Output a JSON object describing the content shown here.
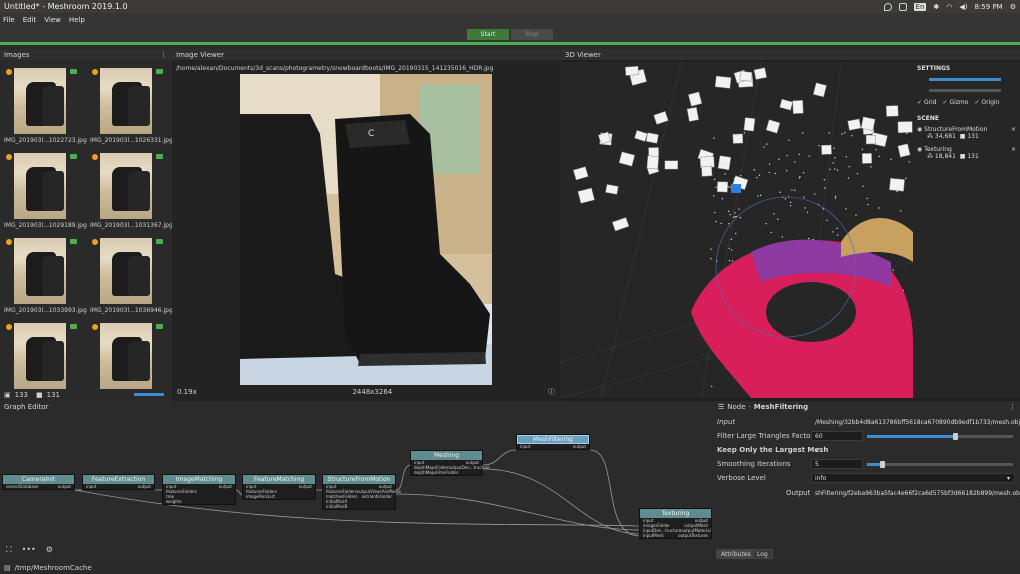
{
  "window": {
    "title": "Untitled* - Meshroom 2019.1.0",
    "clock": "8:59 PM",
    "keyboard_layout": "En"
  },
  "menu": [
    "File",
    "Edit",
    "View",
    "Help"
  ],
  "toolbar": {
    "start_label": "Start",
    "stop_label": "Stop",
    "progress_color": "#4caf50"
  },
  "images_panel": {
    "title": "Images",
    "thumbnails": [
      {
        "label": "IMG_201903l...1022723.jpg"
      },
      {
        "label": "IMG_201903l...1026331.jpg"
      },
      {
        "label": "IMG_201903l...1029189.jpg"
      },
      {
        "label": "IMG_201903l...1031367.jpg"
      },
      {
        "label": "IMG_201903l...1033993.jpg"
      },
      {
        "label": "IMG_201903l...1036946.jpg"
      },
      {
        "label": ""
      },
      {
        "label": ""
      }
    ],
    "image_count": "133",
    "camera_count": "131"
  },
  "image_viewer": {
    "title": "Image Viewer",
    "path": "/home/alexan/Documents/3d_scans/photogrametry/snowboardboots/IMG_20190315_141235016_HDR.jpg",
    "zoom": "0.19x",
    "resolution": "2448x3264",
    "boot_logo": "C"
  },
  "viewer_3d": {
    "title": "3D Viewer",
    "settings_label": "SETTINGS",
    "grid_label": "Grid",
    "gizmo_label": "Gizmo",
    "origin_label": "Origin",
    "scene_label": "SCENE",
    "scene_items": [
      {
        "name": "StructureFromMotion",
        "a": "34,681",
        "b": "131"
      },
      {
        "name": "Texturing",
        "a": "18,841",
        "b": "131"
      }
    ]
  },
  "graph_editor": {
    "title": "Graph Editor",
    "nodes": [
      {
        "id": "camerainit",
        "name": "CameraInit",
        "inputs": [
          "sensorDatabase"
        ],
        "outputs": [
          "output"
        ]
      },
      {
        "id": "featureextraction",
        "name": "FeatureExtraction",
        "inputs": [
          "input"
        ],
        "outputs": [
          "output"
        ]
      },
      {
        "id": "imagematching",
        "name": "ImageMatching",
        "inputs": [
          "input",
          "featuresFolders",
          "tree",
          "weights"
        ],
        "outputs": [
          "output"
        ]
      },
      {
        "id": "featurematching",
        "name": "FeatureMatching",
        "inputs": [
          "input",
          "featuresFolders",
          "imagePairsList"
        ],
        "outputs": [
          "output"
        ]
      },
      {
        "id": "sfm",
        "name": "StructureFromMotion",
        "inputs": [
          "input",
          "featuresFolders",
          "matchesFolders",
          "initialPairA",
          "initialPairB"
        ],
        "outputs": [
          "output",
          "outputViewsAndPoses",
          "extraInfoFolder"
        ]
      },
      {
        "id": "meshing",
        "name": "Meshing",
        "inputs": [
          "input",
          "depthMapsFolder",
          "depthMapsFilterFolder"
        ],
        "outputs": [
          "output",
          "outputDen...tructure"
        ]
      },
      {
        "id": "meshfiltering",
        "name": "MeshFiltering",
        "inputs": [
          "input"
        ],
        "outputs": [
          "output"
        ]
      },
      {
        "id": "texturing",
        "name": "Texturing",
        "inputs": [
          "input",
          "imagesFolder",
          "inputDen...tructure",
          "inputMesh"
        ],
        "outputs": [
          "output",
          "outputMesh",
          "outputMaterial",
          "outputTextures"
        ]
      }
    ],
    "cache_path": "/tmp/MeshroomCache"
  },
  "node_editor": {
    "title_prefix": "Node",
    "title_name": "MeshFiltering",
    "input_label": "Input",
    "input_value": "/Meshing/32bb4d8a613786bff5618ca670890db9edf1b733/mesh.obj",
    "filter_label": "Filter Large Triangles Factor",
    "filter_value": "60",
    "filter_fraction": 0.6,
    "keep_label": "Keep Only the Largest Mesh",
    "keep_checked": "✓",
    "smoothing_label": "Smoothing Iterations",
    "smoothing_value": "5",
    "smoothing_fraction": 0.1,
    "verbose_label": "Verbose Level",
    "verbose_value": "info",
    "output_label": "Output",
    "output_value": "shFiltering/f2eba963ba5fac4e66f2ca6d575bf3d66182b899/mesh.obj",
    "tabs": [
      "Attributes",
      "Log"
    ]
  }
}
